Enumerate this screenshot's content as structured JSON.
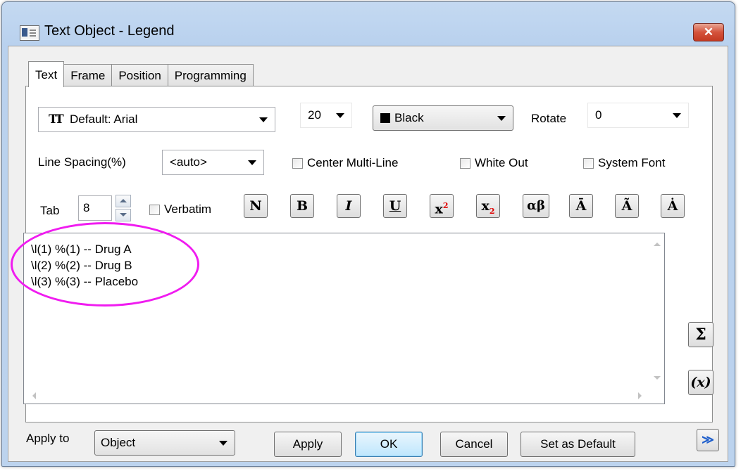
{
  "window": {
    "title": "Text Object - Legend",
    "close_label": "✕"
  },
  "tabs": [
    {
      "label": "Text",
      "active": true
    },
    {
      "label": "Frame",
      "active": false
    },
    {
      "label": "Position",
      "active": false
    },
    {
      "label": "Programming",
      "active": false
    }
  ],
  "font": {
    "icon": "font-icon",
    "value": "Default: Arial"
  },
  "size": {
    "value": "20"
  },
  "color": {
    "value": "Black",
    "swatch": "#000000"
  },
  "rotate": {
    "label": "Rotate",
    "value": "0"
  },
  "line_spacing": {
    "label": "Line Spacing(%)",
    "value": "<auto>"
  },
  "checkboxes": {
    "center_multiline": {
      "label": "Center Multi-Line",
      "checked": false
    },
    "white_out": {
      "label": "White Out",
      "checked": false
    },
    "system_font": {
      "label": "System Font",
      "checked": false
    },
    "verbatim": {
      "label": "Verbatim",
      "checked": false
    }
  },
  "tab": {
    "label": "Tab",
    "value": "8"
  },
  "format_buttons": {
    "normal": "N",
    "bold": "B",
    "italic": "I",
    "underline": "U",
    "superscript_base": "x",
    "superscript_exp": "2",
    "subscript_base": "x",
    "subscript_idx": "2",
    "greek": "αβ",
    "overbar": "Ā",
    "tilde": "Ã",
    "dot": "Ȧ"
  },
  "editor": {
    "lines": [
      "\\l(1) %(1) -- Drug A",
      "\\l(2) %(2) -- Drug B",
      "\\l(3) %(3) -- Placebo"
    ]
  },
  "side_buttons": {
    "sigma": "Σ",
    "variable": "(x)"
  },
  "footer": {
    "apply_to_label": "Apply to",
    "apply_to_value": "Object",
    "apply": "Apply",
    "ok": "OK",
    "cancel": "Cancel",
    "set_default": "Set as Default",
    "expand": "≫"
  },
  "colors": {
    "highlight_ellipse": "#f01cf0",
    "sup_sub": "#e00000"
  }
}
